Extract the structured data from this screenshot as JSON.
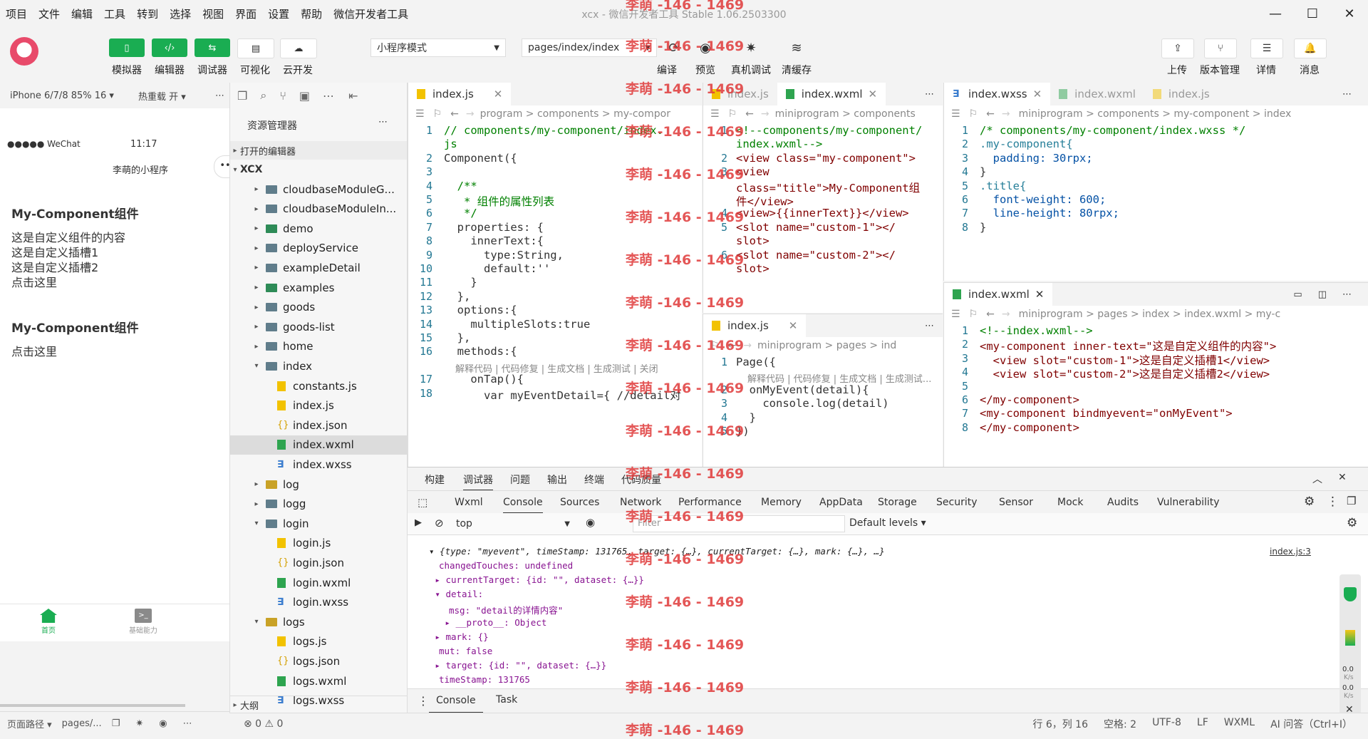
{
  "menu": [
    "项目",
    "文件",
    "编辑",
    "工具",
    "转到",
    "选择",
    "视图",
    "界面",
    "设置",
    "帮助",
    "微信开发者工具"
  ],
  "window_title": "xcx - 微信开发者工具 Stable 1.06.2503300",
  "toolbar": {
    "left_buttons": [
      {
        "label": "模拟器",
        "icon": "phone-icon"
      },
      {
        "label": "编辑器",
        "icon": "code-icon"
      },
      {
        "label": "调试器",
        "icon": "debug-icon"
      },
      {
        "label": "可视化",
        "icon": "layout-icon"
      },
      {
        "label": "云开发",
        "icon": "cloud-icon"
      }
    ],
    "mode_select": "小程序模式",
    "page_select": "pages/index/index",
    "mid_buttons": [
      {
        "label": "编译",
        "icon": "refresh-icon"
      },
      {
        "label": "预览",
        "icon": "eye-icon"
      },
      {
        "label": "真机调试",
        "icon": "bug-icon"
      },
      {
        "label": "清缓存",
        "icon": "layers-icon"
      }
    ],
    "right_buttons": [
      {
        "label": "上传",
        "icon": "upload-icon"
      },
      {
        "label": "版本管理",
        "icon": "branch-icon"
      },
      {
        "label": "详情",
        "icon": "menu-icon"
      },
      {
        "label": "消息",
        "icon": "bell-icon"
      }
    ]
  },
  "simulator": {
    "device": "iPhone 6/7/8 85% 16 ▾",
    "hot_reload": "热重载 开 ▾",
    "status_carrier": "●●●●● WeChat",
    "status_time": "11:17",
    "nav_title": "李萌的小程序",
    "blocks": [
      {
        "heading": "My-Component组件",
        "lines": [
          "这是自定义组件的内容",
          "这是自定义插槽1",
          "这是自定义插槽2",
          "点击这里"
        ]
      },
      {
        "heading": "My-Component组件",
        "lines": [
          "点击这里"
        ]
      }
    ],
    "tabbar": [
      {
        "label": "首页"
      },
      {
        "label": "基础能力"
      }
    ],
    "footer_path_label": "页面路径 ▾",
    "footer_path": "pages/..."
  },
  "explorer": {
    "title": "资源管理器",
    "open_editors": "打开的编辑器",
    "root": "XCX",
    "items": [
      {
        "name": "cloudbaseModuleG...",
        "type": "folder",
        "level": 1
      },
      {
        "name": "cloudbaseModuleIn...",
        "type": "folder",
        "level": 1
      },
      {
        "name": "demo",
        "type": "folder-green",
        "level": 1
      },
      {
        "name": "deployService",
        "type": "folder",
        "level": 1
      },
      {
        "name": "exampleDetail",
        "type": "folder",
        "level": 1
      },
      {
        "name": "examples",
        "type": "folder-green",
        "level": 1
      },
      {
        "name": "goods",
        "type": "folder",
        "level": 1
      },
      {
        "name": "goods-list",
        "type": "folder",
        "level": 1
      },
      {
        "name": "home",
        "type": "folder",
        "level": 1
      },
      {
        "name": "index",
        "type": "folder-open",
        "level": 1
      },
      {
        "name": "constants.js",
        "type": "js",
        "level": 2
      },
      {
        "name": "index.js",
        "type": "js",
        "level": 2
      },
      {
        "name": "index.json",
        "type": "json",
        "level": 2
      },
      {
        "name": "index.wxml",
        "type": "wxml",
        "level": 2,
        "selected": true
      },
      {
        "name": "index.wxss",
        "type": "wxss",
        "level": 2
      },
      {
        "name": "log",
        "type": "folder-yellow",
        "level": 1
      },
      {
        "name": "logg",
        "type": "folder",
        "level": 1
      },
      {
        "name": "login",
        "type": "folder-open",
        "level": 1
      },
      {
        "name": "login.js",
        "type": "js",
        "level": 2
      },
      {
        "name": "login.json",
        "type": "json",
        "level": 2
      },
      {
        "name": "login.wxml",
        "type": "wxml",
        "level": 2
      },
      {
        "name": "login.wxss",
        "type": "wxss",
        "level": 2
      },
      {
        "name": "logs",
        "type": "folder-open-yellow",
        "level": 1
      },
      {
        "name": "logs.js",
        "type": "js",
        "level": 2
      },
      {
        "name": "logs.json",
        "type": "json",
        "level": 2
      },
      {
        "name": "logs.wxml",
        "type": "wxml",
        "level": 2
      },
      {
        "name": "logs.wxss",
        "type": "wxss",
        "level": 2
      }
    ],
    "outline": "大纲"
  },
  "editor1": {
    "tab": "index.js",
    "breadcrumb": "program > components > my-compor",
    "lines": [
      {
        "n": "1",
        "t": "// components/my-component/index.",
        "k": "com"
      },
      {
        "n": "",
        "t": "js",
        "k": "com"
      },
      {
        "n": "2",
        "t": "Component({",
        "k": "plain"
      },
      {
        "n": "3",
        "t": "",
        "k": "plain"
      },
      {
        "n": "4",
        "t": "  /**",
        "k": "com"
      },
      {
        "n": "5",
        "t": "   * 组件的属性列表",
        "k": "com"
      },
      {
        "n": "6",
        "t": "   */",
        "k": "com"
      },
      {
        "n": "7",
        "t": "  properties: {",
        "k": "plain"
      },
      {
        "n": "8",
        "t": "    innerText:{",
        "k": "plain"
      },
      {
        "n": "9",
        "t": "      type:String,",
        "k": "plain"
      },
      {
        "n": "10",
        "t": "      default:''",
        "k": "plain"
      },
      {
        "n": "11",
        "t": "    }",
        "k": "plain"
      },
      {
        "n": "12",
        "t": "  },",
        "k": "plain"
      },
      {
        "n": "13",
        "t": "  options:{",
        "k": "plain"
      },
      {
        "n": "14",
        "t": "    multipleSlots:true",
        "k": "plain"
      },
      {
        "n": "15",
        "t": "  },",
        "k": "plain"
      },
      {
        "n": "16",
        "t": "  methods:{",
        "k": "plain"
      },
      {
        "n": "",
        "t": "解释代码 | 代码修复 | 生成文档 | 生成测试 | 关闭",
        "k": "hint"
      },
      {
        "n": "17",
        "t": "    onTap(){",
        "k": "plain"
      },
      {
        "n": "18",
        "t": "      var myEventDetail={ //detail对",
        "k": "plain"
      }
    ]
  },
  "editor2": {
    "tab_dim": "index.js",
    "tab": "index.wxml",
    "breadcrumb": "miniprogram > components",
    "lines": [
      {
        "n": "1",
        "t": "<!--components/my-component/",
        "k": "com"
      },
      {
        "n": "",
        "t": "index.wxml-->",
        "k": "com"
      },
      {
        "n": "2",
        "t": "<view class=\"my-component\">",
        "k": "tag"
      },
      {
        "n": "3",
        "t": "<view",
        "k": "tag"
      },
      {
        "n": "",
        "t": "class=\"title\">My-Component组",
        "k": "tag"
      },
      {
        "n": "",
        "t": "件</view>",
        "k": "tag"
      },
      {
        "n": "4",
        "t": "<view>{{innerText}}</view>",
        "k": "tag"
      },
      {
        "n": "5",
        "t": "<slot name=\"custom-1\"></",
        "k": "tag"
      },
      {
        "n": "",
        "t": "slot>",
        "k": "tag"
      },
      {
        "n": "6",
        "t": "<slot name=\"custom-2\"></",
        "k": "tag"
      },
      {
        "n": "",
        "t": "slot>",
        "k": "tag"
      }
    ]
  },
  "editor3": {
    "tab": "index.js",
    "breadcrumb": "miniprogram > pages > ind",
    "lines": [
      {
        "n": "1",
        "t": "Page({",
        "k": "plain"
      },
      {
        "n": "",
        "t": "解释代码 | 代码修复 | 生成文档 | 生成测试...",
        "k": "hint"
      },
      {
        "n": "2",
        "t": "  onMyEvent(detail){",
        "k": "plain"
      },
      {
        "n": "3",
        "t": "    console.log(detail)",
        "k": "plain"
      },
      {
        "n": "4",
        "t": "  }",
        "k": "plain"
      },
      {
        "n": "5",
        "t": "})",
        "k": "plain"
      }
    ]
  },
  "editor4": {
    "tabs": [
      "index.wxss",
      "index.wxml",
      "index.js"
    ],
    "breadcrumb": "miniprogram > components > my-component > index",
    "lines": [
      {
        "n": "1",
        "t": "/* components/my-component/index.wxss */",
        "k": "com"
      },
      {
        "n": "2",
        "t": ".my-component{",
        "k": "cls"
      },
      {
        "n": "3",
        "t": "  padding: 30rpx;",
        "k": "prop"
      },
      {
        "n": "4",
        "t": "}",
        "k": "plain"
      },
      {
        "n": "5",
        "t": ".title{",
        "k": "cls"
      },
      {
        "n": "6",
        "t": "  font-weight: 600;",
        "k": "prop"
      },
      {
        "n": "7",
        "t": "  line-height: 80rpx;",
        "k": "prop"
      },
      {
        "n": "8",
        "t": "}",
        "k": "plain"
      }
    ]
  },
  "editor5": {
    "tab": "index.wxml",
    "breadcrumb": "miniprogram > pages > index > index.wxml > my-c",
    "lines": [
      {
        "n": "1",
        "t": "<!--index.wxml-->",
        "k": "com"
      },
      {
        "n": "2",
        "t": "<my-component inner-text=\"这是自定义组件的内容\">",
        "k": "tag"
      },
      {
        "n": "3",
        "t": "  <view slot=\"custom-1\">这是自定义插槽1</view>",
        "k": "tag"
      },
      {
        "n": "4",
        "t": "  <view slot=\"custom-2\">这是自定义插槽2</view>",
        "k": "tag"
      },
      {
        "n": "5",
        "t": "",
        "k": "plain"
      },
      {
        "n": "6",
        "t": "</my-component>",
        "k": "tag"
      },
      {
        "n": "7",
        "t": "<my-component bindmyevent=\"onMyEvent\">",
        "k": "tag"
      },
      {
        "n": "8",
        "t": "</my-component>",
        "k": "tag"
      }
    ]
  },
  "debugger": {
    "top_tabs": [
      "构建",
      "调试器",
      "问题",
      "输出",
      "终端",
      "代码质量"
    ],
    "devtabs": [
      "Wxml",
      "Console",
      "Sources",
      "Network",
      "Performance",
      "Memory",
      "AppData",
      "Storage",
      "Security",
      "Sensor",
      "Mock",
      "Audits",
      "Vulnerability"
    ],
    "context": "top",
    "filter_placeholder": "Filter",
    "levels": "Default levels ▾",
    "source_link": "index.js:3",
    "log_lines": [
      {
        "t": "▾ {type: \"myevent\", timeStamp: 131765, target: {…}, currentTarget: {…}, mark: {…}, …}",
        "indent": 0
      },
      {
        "t": "changedTouches: undefined",
        "indent": 1
      },
      {
        "t": "▸ currentTarget: {id: \"\", dataset: {…}}",
        "indent": 0.6
      },
      {
        "t": "▾ detail:",
        "indent": 0.6
      },
      {
        "t": "msg: \"detail的详情内容\"",
        "indent": 2
      },
      {
        "t": "▸ __proto__: Object",
        "indent": 1.6
      },
      {
        "t": "▸ mark: {}",
        "indent": 0.6
      },
      {
        "t": "mut: false",
        "indent": 1
      },
      {
        "t": "▸ target: {id: \"\", dataset: {…}}",
        "indent": 0.6
      },
      {
        "t": "timeStamp: 131765",
        "indent": 1
      }
    ],
    "bottom_tabs": [
      "Console",
      "Task"
    ],
    "side_readout": [
      "0.0",
      "K/s",
      "0.0",
      "K/s"
    ]
  },
  "statusbar": {
    "errors": "⊗ 0 ⚠ 0",
    "items": [
      "行 6，列 16",
      "空格: 2",
      "UTF-8",
      "LF",
      "WXML",
      "AI 问答（Ctrl+I）"
    ]
  },
  "watermark": "李萌 -146 - 1469",
  "colors": {
    "accent_green": "#1aad52",
    "watermark_red": "#e03a3a"
  }
}
